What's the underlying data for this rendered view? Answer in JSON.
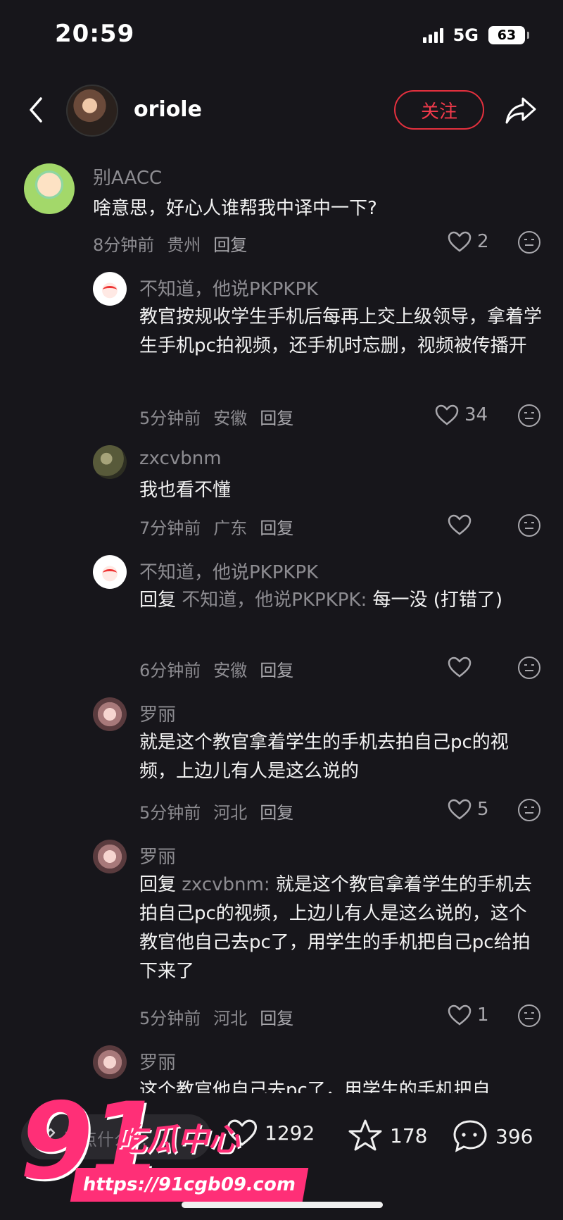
{
  "status_bar": {
    "time": "20:59",
    "network": "5G",
    "battery": "63"
  },
  "header": {
    "username": "oriole",
    "follow_label": "关注"
  },
  "comments": [
    {
      "name": "别AACC",
      "text": "啥意思，好心人谁帮我中译中一下?",
      "time": "8分钟前",
      "location": "贵州",
      "reply_label": "回复",
      "likes": "2"
    },
    {
      "name": "不知道，他说PKPKPK",
      "text": "教官按规收学生手机后每再上交上级领导，拿着学生手机pc拍视频，还手机时忘删，视频被传播开",
      "time": "5分钟前",
      "location": "安徽",
      "reply_label": "回复",
      "likes": "34"
    },
    {
      "name": "zxcvbnm",
      "text": "我也看不懂",
      "time": "7分钟前",
      "location": "广东",
      "reply_label": "回复",
      "likes": ""
    },
    {
      "name": "不知道，他说PKPKPK",
      "reply_prefix": "回复",
      "reply_to": "不知道，他说PKPKPK:",
      "text": "每一没 (打错了)",
      "time": "6分钟前",
      "location": "安徽",
      "reply_label": "回复",
      "likes": ""
    },
    {
      "name": "罗丽",
      "text": "就是这个教官拿着学生的手机去拍自己pc的视频，上边儿有人是这么说的",
      "time": "5分钟前",
      "location": "河北",
      "reply_label": "回复",
      "likes": "5"
    },
    {
      "name": "罗丽",
      "reply_prefix": "回复",
      "reply_to": "zxcvbnm:",
      "text": "就是这个教官拿着学生的手机去拍自己pc的视频，上边儿有人是这么说的，这个教官他自己去pc了，用学生的手机把自己pc给拍下来了",
      "time": "5分钟前",
      "location": "河北",
      "reply_label": "回复",
      "likes": "1"
    },
    {
      "name": "罗丽",
      "text": "这个教官他自己去pc了，用学生的手机把自"
    }
  ],
  "bottom_bar": {
    "input_placeholder": "说点什么...",
    "likes": "1292",
    "favorites": "178",
    "comments": "396"
  },
  "watermark": {
    "number": "91",
    "brand": "吃瓜中心",
    "url": "https://91cgb09.com"
  },
  "colors": {
    "background": "#17161b",
    "accent": "#e5303e",
    "watermark": "#ff2f77",
    "muted_text": "#8d8c91"
  }
}
